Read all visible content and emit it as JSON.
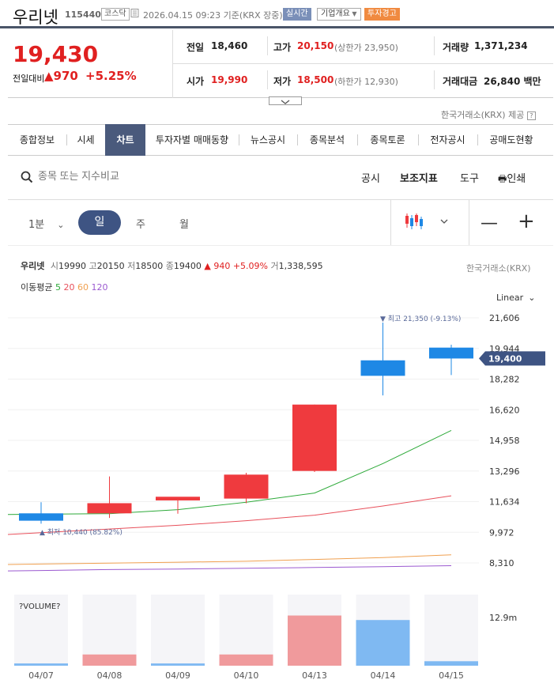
{
  "header": {
    "name": "우리넷",
    "code": "115440",
    "market": "코스닥",
    "datetime": "2026.04.15 09:23 기준(KRX 장중)",
    "realtime": "실시간",
    "company": "기업개요",
    "warning": "투자경고"
  },
  "price": {
    "current": "19,430",
    "prev_label": "전일대비",
    "change": "970",
    "change_pct": "+5.25%"
  },
  "stats": {
    "prev_label": "전일",
    "prev": "18,460",
    "high_label": "고가",
    "high": "20,150",
    "upper_limit": "(상한가 23,950)",
    "volume_label": "거래량",
    "volume": "1,371,234",
    "open_label": "시가",
    "open": "19,990",
    "low_label": "저가",
    "low": "18,500",
    "lower_limit": "(하한가 12,930)",
    "amount_label": "거래대금",
    "amount": "26,840 백만"
  },
  "source_note": "한국거래소(KRX) 제공",
  "tabs": [
    "종합정보",
    "시세",
    "차트",
    "투자자별 매매동향",
    "뉴스공시",
    "종목분석",
    "종목토론",
    "전자공시",
    "공매도현황"
  ],
  "active_tab": "차트",
  "toolbar": {
    "search_placeholder": "종목 또는 지수비교",
    "disclosure": "공시",
    "indicator": "보조지표",
    "tools": "도구",
    "print": "인쇄"
  },
  "period": {
    "minute": "1분",
    "day": "일",
    "week": "주",
    "month": "월"
  },
  "info_line": {
    "name": "우리넷",
    "open_l": "시",
    "open": "19990",
    "high_l": "고",
    "high": "20150",
    "low_l": "저",
    "low": "18500",
    "close_l": "종",
    "close": "19400",
    "change": "▲ 940",
    "pct": "+5.09%",
    "vol_l": "거",
    "vol": "1,338,595"
  },
  "exchange": "한국거래소(KRX)",
  "ma": {
    "label": "이동평균",
    "p5": "5",
    "p20": "20",
    "p60": "60",
    "p120": "120",
    "c5": "#2eaa3a",
    "c20": "#e8505b",
    "c60": "#f0a050",
    "c120": "#9b59d0"
  },
  "scale_label": "Linear",
  "colors": {
    "up": "#ef3a3e",
    "down": "#1e88e5",
    "current_price_bg": "#3e5483"
  },
  "chart_data": {
    "type": "candlestick",
    "dates": [
      "04/07",
      "04/08",
      "04/09",
      "04/10",
      "04/13",
      "04/14",
      "04/15"
    ],
    "candles": [
      {
        "open": 11000,
        "high": 11600,
        "low": 10440,
        "close": 10600
      },
      {
        "open": 11000,
        "high": 13000,
        "low": 10750,
        "close": 11550
      },
      {
        "open": 11700,
        "high": 11700,
        "low": 10980,
        "close": 11900
      },
      {
        "open": 11800,
        "high": 13200,
        "low": 11550,
        "close": 13100
      },
      {
        "open": 13300,
        "high": 16900,
        "low": 13240,
        "close": 16900
      },
      {
        "open": 19300,
        "high": 21350,
        "low": 17400,
        "close": 18460
      },
      {
        "open": 19990,
        "high": 20150,
        "low": 18500,
        "close": 19400
      }
    ],
    "ma5": [
      10950,
      10980,
      11200,
      11600,
      12100,
      13700,
      15500
    ],
    "ma20": [
      9950,
      10150,
      10350,
      10600,
      10900,
      11400,
      11950
    ],
    "ma60": [
      8250,
      8300,
      8350,
      8400,
      8500,
      8600,
      8750
    ],
    "ma120": [
      7900,
      7950,
      7980,
      8020,
      8060,
      8110,
      8160
    ],
    "max_label": "최고 21,350 (-9.13%)",
    "min_label": "최저 10,440 (85.82%)",
    "y_ticks": [
      "21,606",
      "19,944",
      "18,282",
      "16,620",
      "14,958",
      "13,296",
      "11,634",
      "9,972",
      "8,310"
    ],
    "y_range": [
      8310,
      21606
    ],
    "current_label": "19,400",
    "volume_title": "?VOLUME?",
    "volume_tick": "12.9m",
    "volume": [
      {
        "value": 0.03,
        "dir": "down"
      },
      {
        "value": 0.15,
        "dir": "up"
      },
      {
        "value": 0.03,
        "dir": "down"
      },
      {
        "value": 0.15,
        "dir": "up"
      },
      {
        "value": 0.67,
        "dir": "up"
      },
      {
        "value": 0.61,
        "dir": "down"
      },
      {
        "value": 0.06,
        "dir": "down"
      }
    ]
  }
}
